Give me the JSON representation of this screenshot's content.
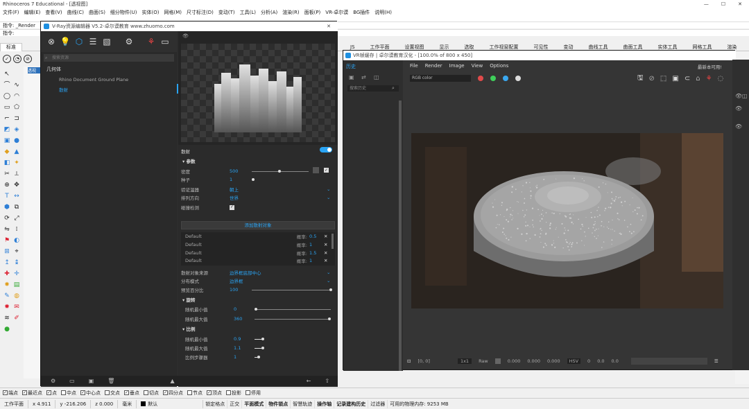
{
  "rhino": {
    "title": "Rhinoceros 7 Educational - [透视图]",
    "menus": [
      "文件(F)",
      "编辑(E)",
      "查看(V)",
      "曲线(C)",
      "曲面(S)",
      "细分物件(U)",
      "实体(O)",
      "网格(M)",
      "尺寸标注(D)",
      "变动(T)",
      "工具(L)",
      "分析(A)",
      "渲染(R)",
      "面板(P)",
      "VR-卓尔谟",
      "BG插件",
      "说明(H)"
    ],
    "command_history": "指令: _Render",
    "command_prompt": "指令:",
    "tabs": [
      "标准",
      "工作平面",
      "设置视图",
      "显示",
      "选取",
      "工作视窗配置",
      "可见性",
      "变动",
      "曲线工具",
      "曲面工具",
      "实体工具",
      "网格工具",
      "渲染"
    ],
    "tabs_prefix": "JS",
    "viewport_tab": "透视",
    "snaps": [
      {
        "label": "端点",
        "checked": true
      },
      {
        "label": "最近点",
        "checked": true
      },
      {
        "label": "点",
        "checked": true
      },
      {
        "label": "中点",
        "checked": false
      },
      {
        "label": "中心点",
        "checked": true
      },
      {
        "label": "交点",
        "checked": false
      },
      {
        "label": "垂点",
        "checked": true
      },
      {
        "label": "切点",
        "checked": false
      },
      {
        "label": "四分点",
        "checked": true
      },
      {
        "label": "节点",
        "checked": false
      },
      {
        "label": "顶点",
        "checked": true
      },
      {
        "label": "投影",
        "checked": false
      },
      {
        "label": "停用",
        "checked": false
      }
    ],
    "status": {
      "plane": "工作平面",
      "x": "x 4.911",
      "y": "y -216.206",
      "z": "z 0.000",
      "unit": "毫米",
      "layer": "默认",
      "buttons": [
        "锁定格点",
        "正交",
        "平面模式",
        "物件锁点",
        "智慧轨迹",
        "操作轴",
        "记录建构历史",
        "过滤器"
      ],
      "memory": "可用的物理内存: 9253 MB"
    }
  },
  "asset_editor": {
    "title": "V-Ray资源编辑器 V5.2-卓尔谟教育 www.zhuomo.com",
    "search_placeholder": "搜索资源",
    "tree_head": "几何体",
    "items": [
      {
        "label": "Rhino Document Ground Plane",
        "selected": false
      },
      {
        "label": "散射",
        "selected": true
      }
    ],
    "panel_title": "散射",
    "section_params": "参数",
    "density_label": "密度",
    "density_value": "500",
    "seed_label": "种子",
    "seed_value": "1",
    "filter_label": "验证温器",
    "filter_value": "朝上",
    "direction_label": "排列方向",
    "direction_value": "世界",
    "collision_label": "碰撞检测",
    "collision_checked": true,
    "add_button": "添加散射对象",
    "list": [
      {
        "name": "Default",
        "prob_label": "概率:",
        "prob": "0.5"
      },
      {
        "name": "Default",
        "prob_label": "概率:",
        "prob": "1"
      },
      {
        "name": "Default",
        "prob_label": "概率:",
        "prob": "1.5"
      },
      {
        "name": "Default",
        "prob_label": "概率:",
        "prob": "1"
      }
    ],
    "source_label": "散射对象来源",
    "source_value": "边界框底部中心",
    "mode_label": "分布模式",
    "mode_value": "边界框",
    "percent_label": "预览百分比",
    "percent_value": "100",
    "section_rotation": "旋转",
    "rot_min_label": "随机最小值",
    "rot_min_value": "0",
    "rot_max_label": "随机最大值",
    "rot_max_value": "360",
    "section_scale": "比例",
    "sc_min_label": "随机最小值",
    "sc_min_value": "0.9",
    "sc_max_label": "随机最大值",
    "sc_max_value": "1.1",
    "sc_step_label": "比例步骤器",
    "sc_step_value": "1"
  },
  "vfb": {
    "title": "VR帧缓存 | 卓尔谟教育汉化 - [100.0% of 800 x 450]",
    "history_title": "历史",
    "history_search": "搜索历史",
    "menus": [
      "File",
      "Render",
      "Image",
      "View",
      "Options"
    ],
    "right_note": "最新本可用!",
    "channel": "RGB color",
    "dot_colors": [
      "#e04a4a",
      "#3fcf5a",
      "#3aa8f0",
      "#dddddd"
    ],
    "bottom": {
      "coords": "[0, 0]",
      "mode": "1x1",
      "raw": "Raw",
      "v1": "0.000",
      "v2": "0.000",
      "v3": "0.000",
      "space": "HSV",
      "h1": "0",
      "h2": "0.0",
      "h3": "0.0"
    }
  },
  "right_panel": {
    "label": "属性"
  }
}
